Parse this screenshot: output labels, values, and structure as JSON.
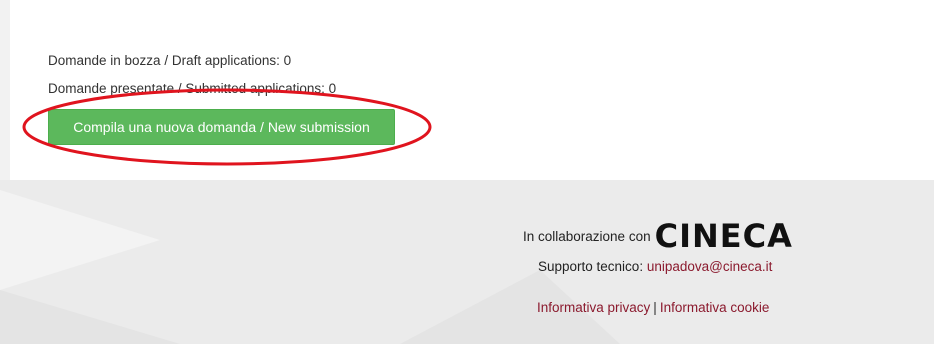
{
  "applications": {
    "draft_text": "Domande in bozza / Draft applications: 0",
    "submitted_text": "Domande presentate / Submitted applications: 0",
    "new_submission_label": "Compila una nuova domanda / New submission"
  },
  "footer": {
    "collaboration_text": "In collaborazione con",
    "partner_logo_text": "CINECA",
    "support_label": "Supporto tecnico:",
    "support_email": "unipadova@cineca.it",
    "privacy_label": "Informativa privacy",
    "separator": "|",
    "cookie_label": "Informativa cookie"
  },
  "colors": {
    "button_green": "#5cb85c",
    "link_color": "#8b1a2e",
    "annotation_red": "#e0141e",
    "footer_bg": "#ebebeb"
  }
}
